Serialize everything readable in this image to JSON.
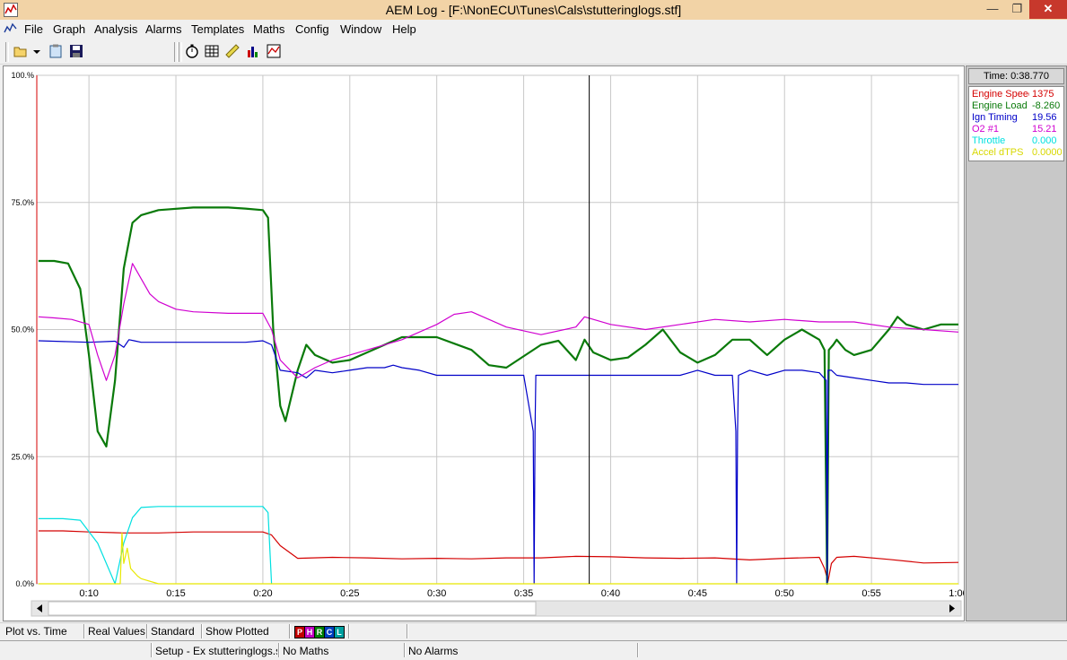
{
  "window": {
    "title": "AEM Log - [F:\\NonECU\\Tunes\\Cals\\stutteringlogs.stf]",
    "controls": {
      "minimize": "—",
      "maximize": "❐",
      "close": "✕"
    }
  },
  "menu": {
    "items": [
      "File",
      "Graph",
      "Analysis",
      "Alarms",
      "Templates",
      "Maths",
      "Config",
      "Window",
      "Help"
    ]
  },
  "toolbar": {
    "icons": [
      "open-folder-icon",
      "dropdown-arrow-icon",
      "clipboard-icon",
      "save-icon",
      "stopwatch-icon",
      "table-icon",
      "ruler-icon",
      "bar-chart-icon",
      "grid-chart-icon"
    ]
  },
  "side_panel": {
    "time_label": "Time: 0:38.770",
    "channels": [
      {
        "name": "Engine Speed",
        "value": "1375",
        "color": "#d40000"
      },
      {
        "name": "Engine Load",
        "value": "-8.260",
        "color": "#0a7a0a"
      },
      {
        "name": "Ign Timing",
        "value": "19.56",
        "color": "#0000c8"
      },
      {
        "name": "O2 #1",
        "value": "15.21",
        "color": "#d000d0"
      },
      {
        "name": "Throttle",
        "value": "0.000",
        "color": "#00e0e0"
      },
      {
        "name": "Accel dTPS",
        "value": "0.0000",
        "color": "#e8e800"
      }
    ]
  },
  "status": {
    "cells": [
      "Plot vs. Time",
      "Real Values",
      "Standard",
      "Show Plotted"
    ],
    "view_chips": [
      "P",
      "H",
      "R",
      "C",
      "L"
    ],
    "bottom": [
      "Setup - Ex stutteringlogs.s",
      "No Maths",
      "No Alarms"
    ]
  },
  "chart_data": {
    "type": "line",
    "xlabel": "",
    "ylabel": "",
    "xlim_seconds": [
      7,
      60
    ],
    "ylim_percent": [
      0,
      100
    ],
    "x_tick_labels": [
      "0:10",
      "0:15",
      "0:20",
      "0:25",
      "0:30",
      "0:35",
      "0:40",
      "0:45",
      "0:50",
      "0:55",
      "1:00"
    ],
    "x_tick_values": [
      10,
      15,
      20,
      25,
      30,
      35,
      40,
      45,
      50,
      55,
      60
    ],
    "y_tick_labels": [
      "100.%",
      "75.0%",
      "50.0%",
      "25.0%",
      "0.0%"
    ],
    "y_tick_values": [
      100,
      75,
      50,
      25,
      0
    ],
    "cursor_time": 38.77,
    "grid": true,
    "series": [
      {
        "name": "Engine Speed",
        "color": "#d40000",
        "x": [
          7.1,
          8.5,
          10,
          12,
          14,
          16,
          18,
          20,
          20.5,
          21,
          22,
          24,
          26,
          28,
          30,
          32,
          34,
          36,
          38,
          40,
          42,
          44,
          46,
          48,
          50,
          52,
          52.3,
          52.5,
          52.7,
          53,
          54,
          56,
          58,
          60
        ],
        "y": [
          10.4,
          10.4,
          10.2,
          10,
          10,
          10.2,
          10.2,
          10.2,
          9.6,
          7.5,
          5,
          5.2,
          5.1,
          4.9,
          5.0,
          4.9,
          5.1,
          5.1,
          5.4,
          5.3,
          5.1,
          5.0,
          5.1,
          4.7,
          5.0,
          5.2,
          3,
          0.5,
          4,
          5.2,
          5.4,
          4.8,
          4.1,
          4.2
        ]
      },
      {
        "name": "Engine Load",
        "color": "#0a7a0a",
        "x": [
          7.1,
          8,
          8.8,
          9.5,
          10,
          10.5,
          11,
          11.5,
          12,
          12.5,
          13,
          14,
          16,
          18,
          19,
          20,
          20.3,
          20.6,
          21,
          21.3,
          22,
          22.5,
          23,
          24,
          25,
          27,
          28,
          30,
          32,
          33,
          34,
          36,
          37,
          38,
          38.5,
          39,
          40,
          41,
          42,
          43,
          44,
          45,
          46,
          47,
          48,
          49,
          50,
          51,
          52,
          52.3,
          52.45,
          52.55,
          52.8,
          53,
          53.5,
          54,
          55,
          56,
          56.5,
          57,
          58,
          59,
          60
        ],
        "y": [
          63.5,
          63.5,
          63.0,
          58,
          45,
          30,
          27,
          40,
          62,
          71,
          72.5,
          73.5,
          74,
          74,
          73.8,
          73.5,
          72,
          50,
          35,
          32,
          42,
          47,
          45,
          43.5,
          44,
          47,
          48.5,
          48.5,
          46,
          43,
          42.5,
          47,
          47.8,
          44,
          48,
          45.5,
          44,
          44.5,
          47,
          50,
          45.5,
          43.5,
          45,
          48,
          48,
          45,
          48,
          50,
          48,
          46,
          0,
          46,
          47,
          48,
          46,
          45,
          46,
          50,
          52.5,
          51,
          50,
          51,
          51
        ]
      },
      {
        "name": "Ign Timing",
        "color": "#0000c8",
        "x": [
          7.1,
          10,
          11.5,
          12,
          12.3,
          12.6,
          13,
          16,
          19,
          20,
          20.5,
          21,
          22,
          22.5,
          23,
          24,
          25,
          26,
          27,
          27.5,
          28,
          29,
          30,
          31,
          32,
          33,
          34,
          35,
          35.55,
          35.6,
          35.65,
          35.7,
          36,
          37,
          38,
          38.77,
          40,
          42,
          43,
          44,
          45,
          46,
          47,
          47.2,
          47.25,
          47.3,
          47.35,
          48,
          49,
          50,
          51,
          52,
          52.4,
          52.45,
          52.5,
          52.7,
          53,
          54,
          55,
          56,
          57,
          58,
          59,
          60
        ],
        "y": [
          47.8,
          47.5,
          47.7,
          46.5,
          48,
          47.8,
          47.5,
          47.5,
          47.5,
          47.8,
          47,
          42,
          41.5,
          40.5,
          42,
          41.5,
          42,
          42.5,
          42.5,
          43,
          42.5,
          42,
          41,
          41,
          41,
          41,
          41,
          41,
          30,
          0,
          30,
          41,
          41,
          41,
          41,
          41,
          41,
          41,
          41,
          41,
          42,
          41,
          41,
          30,
          0,
          30,
          41,
          42,
          41,
          42,
          42,
          41.5,
          40,
          0,
          42,
          42,
          41,
          40.5,
          40,
          39.5,
          39.5,
          39.2,
          39.2,
          39.2
        ]
      },
      {
        "name": "O2 #1",
        "color": "#d000d0",
        "x": [
          7.1,
          8,
          9,
          10,
          10.5,
          11,
          11.5,
          12,
          12.5,
          13,
          13.5,
          14,
          15,
          16,
          18,
          20,
          20.5,
          21,
          22,
          23,
          24,
          25,
          26,
          28,
          30,
          31,
          32,
          34,
          36,
          38,
          38.5,
          40,
          42,
          44,
          46,
          48,
          50,
          52,
          54,
          56,
          58,
          60
        ],
        "y": [
          52.5,
          52.3,
          52,
          51,
          45,
          40,
          45,
          55,
          63,
          60,
          57,
          55.5,
          54,
          53.5,
          53.2,
          53.2,
          50,
          44,
          40.5,
          42.5,
          44,
          45,
          46,
          48,
          51,
          53,
          53.5,
          50.5,
          49,
          50.5,
          52.5,
          51,
          50,
          51,
          52,
          51.5,
          52,
          51.5,
          51.5,
          50.5,
          50,
          49.5
        ]
      },
      {
        "name": "Throttle",
        "color": "#00e0e0",
        "x": [
          7.1,
          8.5,
          9.5,
          10.5,
          11.5,
          12,
          12.5,
          13,
          14,
          16,
          18,
          20,
          20.3,
          20.5
        ],
        "y": [
          12.8,
          12.8,
          12.5,
          8,
          0,
          8,
          13,
          15,
          15.2,
          15.2,
          15.2,
          15.2,
          14,
          0
        ]
      },
      {
        "name": "Accel dTPS",
        "color": "#e8e800",
        "x": [
          7.1,
          9.5,
          10,
          11.8,
          11.9,
          12,
          12.2,
          12.4,
          12.8,
          13,
          14,
          60
        ],
        "y": [
          0,
          0,
          0,
          0,
          10,
          4,
          7,
          3,
          1.5,
          1,
          0,
          0
        ]
      }
    ]
  }
}
